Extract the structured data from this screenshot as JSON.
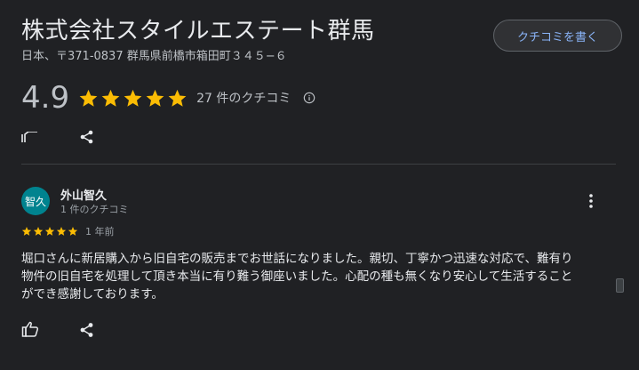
{
  "place": {
    "title": "株式会社スタイルエステート群馬",
    "address": "日本、〒371-0837 群馬県前橋市箱田町３４５−６"
  },
  "header": {
    "write_review_label": "クチコミを書く"
  },
  "rating": {
    "score": "4.9",
    "stars": 5,
    "review_count_label": "27 件のクチコミ"
  },
  "review": {
    "avatar_text": "智久",
    "reviewer_name": "外山智久",
    "reviewer_meta": "1 件のクチコミ",
    "stars": 5,
    "time": "1 年前",
    "text_lines": [
      "堀口さんに新居購入から旧自宅の販売までお世話になりました。親切、丁寧かつ迅速な対応で、難有り",
      "物件の旧自宅を処理して頂き本当に有り難う御座いました。心配の種も無くなり安心して生活すること",
      "ができ感謝しております。"
    ]
  },
  "colors": {
    "background": "#202124",
    "star": "#fbbc04",
    "accent": "#8ab4f8",
    "avatar": "#00838f"
  },
  "icons": [
    "star-icon",
    "info-icon",
    "thumbs-up-icon",
    "share-icon",
    "more-vert-icon"
  ]
}
